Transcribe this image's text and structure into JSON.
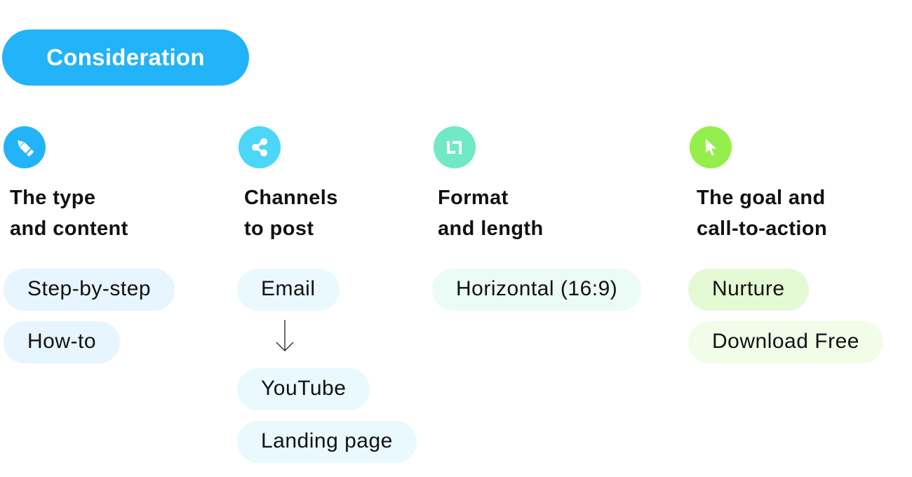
{
  "stage": {
    "label": "Consideration",
    "color": "#22b3f8"
  },
  "columns": [
    {
      "icon": "pencil-icon",
      "icon_color": "#22b3f8",
      "heading": "The type\nand content",
      "pill_color": "#e6f5fe",
      "items": [
        "Step-by-step",
        "How-to"
      ]
    },
    {
      "icon": "share-icon",
      "icon_color": "#4cd6f8",
      "heading": "Channels\nto post",
      "pill_color": "#e9f9fe",
      "items": [
        "Email",
        "YouTube",
        "Landing page"
      ],
      "flow_arrow": "down-arrow-icon between Email and YouTube"
    },
    {
      "icon": "crop-icon",
      "icon_color": "#6fe9c6",
      "heading": "Format\nand length",
      "pill_color": "#ebfbf6",
      "items": [
        "Horizontal (16:9)"
      ]
    },
    {
      "icon": "cursor-icon",
      "icon_color": "#94ef4c",
      "heading": "The goal and\ncall-to-action",
      "pill_colors": [
        "#e3fad5",
        "#f1fce9"
      ],
      "items": [
        "Nurture",
        "Download Free"
      ]
    }
  ]
}
